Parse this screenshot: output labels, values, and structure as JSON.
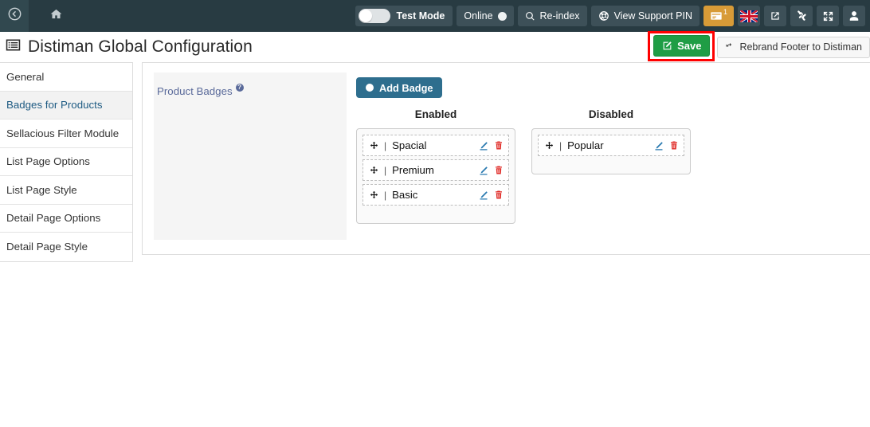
{
  "topbar": {
    "back_icon": "back-arrow-circle-icon",
    "home_icon": "home-icon",
    "test_mode_label": "Test Mode",
    "test_mode_on": false,
    "online_label": "Online",
    "reindex_label": "Re-index",
    "support_pin_label": "View Support PIN",
    "messages_count": "1",
    "icons": [
      "search-icon",
      "lifebuoy-icon",
      "card-icon",
      "uk-flag-icon",
      "external-link-icon",
      "joomla-icon",
      "expand-icon",
      "user-icon"
    ],
    "accent_orange": "#d89b37",
    "background": "#283b42"
  },
  "pagehead": {
    "title": "Distiman Global Configuration",
    "title_icon": "list-panel-icon",
    "save_label": "Save",
    "save_icon": "edit-square-icon",
    "rebrand_label": "Rebrand Footer to Distiman",
    "rebrand_icon": "refresh-icon",
    "save_highlight_color": "#ff0000",
    "save_color": "#1f9d45"
  },
  "sidebar": {
    "items": [
      {
        "label": "General",
        "active": false
      },
      {
        "label": "Badges for Products",
        "active": true
      },
      {
        "label": "Sellacious Filter Module",
        "active": false
      },
      {
        "label": "List Page Options",
        "active": false
      },
      {
        "label": "List Page Style",
        "active": false
      },
      {
        "label": "Detail Page Options",
        "active": false
      },
      {
        "label": "Detail Page Style",
        "active": false
      }
    ]
  },
  "main": {
    "field_label": "Product Badges",
    "help_icon": "question-mark-icon",
    "add_badge_label": "Add Badge",
    "add_badge_icon": "plus-circle-icon",
    "add_badge_color": "#2e6e8e",
    "columns": [
      {
        "title": "Enabled",
        "badges": [
          {
            "name": "Spacial",
            "move_icon": "move-arrows-icon",
            "edit_icon": "pencil-icon",
            "delete_icon": "trash-icon"
          },
          {
            "name": "Premium",
            "move_icon": "move-arrows-icon",
            "edit_icon": "pencil-icon",
            "delete_icon": "trash-icon"
          },
          {
            "name": "Basic",
            "move_icon": "move-arrows-icon",
            "edit_icon": "pencil-icon",
            "delete_icon": "trash-icon"
          }
        ]
      },
      {
        "title": "Disabled",
        "badges": [
          {
            "name": "Popular",
            "move_icon": "move-arrows-icon",
            "edit_icon": "pencil-icon",
            "delete_icon": "trash-icon"
          }
        ]
      }
    ]
  }
}
